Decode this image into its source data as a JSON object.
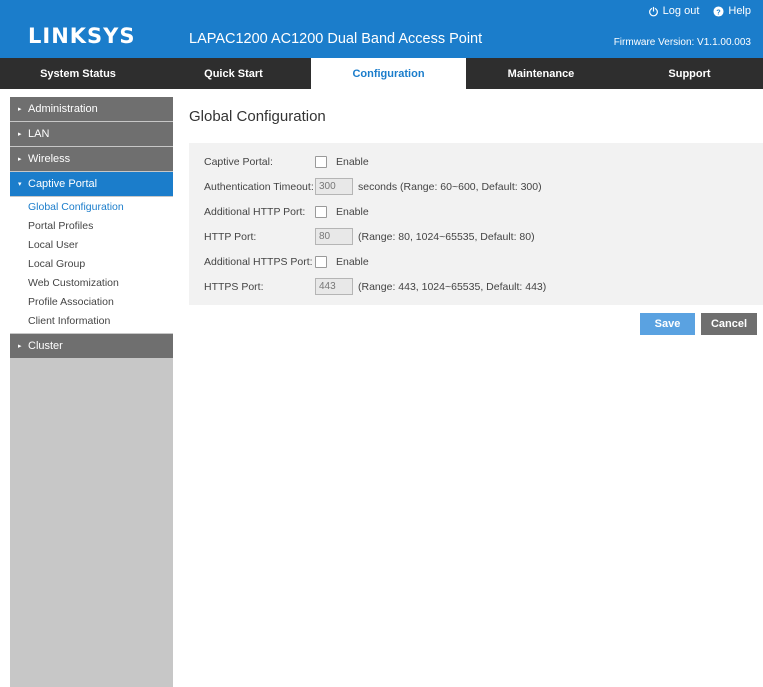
{
  "header": {
    "logo": "LINKSYS",
    "product": "LAPAC1200 AC1200 Dual Band Access Point",
    "logout": "Log out",
    "help": "Help",
    "firmware": "Firmware Version: V1.1.00.003"
  },
  "nav": {
    "tabs": [
      {
        "label": "System Status"
      },
      {
        "label": "Quick Start"
      },
      {
        "label": "Configuration",
        "active": true
      },
      {
        "label": "Maintenance"
      },
      {
        "label": "Support"
      }
    ]
  },
  "sidebar": {
    "sections": [
      {
        "label": "Administration"
      },
      {
        "label": "LAN"
      },
      {
        "label": "Wireless"
      },
      {
        "label": "Captive Portal",
        "active": true,
        "items": [
          "Global Configuration",
          "Portal Profiles",
          "Local User",
          "Local Group",
          "Web Customization",
          "Profile Association",
          "Client Information"
        ]
      },
      {
        "label": "Cluster"
      }
    ]
  },
  "main": {
    "title": "Global Configuration",
    "captive_portal": {
      "label": "Captive Portal:",
      "option": "Enable"
    },
    "auth_timeout": {
      "label": "Authentication Timeout:",
      "value": "300",
      "hint": "seconds (Range: 60~600, Default: 300)"
    },
    "add_http": {
      "label": "Additional HTTP Port:",
      "option": "Enable"
    },
    "http_port": {
      "label": "HTTP Port:",
      "value": "80",
      "hint": "(Range: 80, 1024~65535, Default: 80)"
    },
    "add_https": {
      "label": "Additional HTTPS Port:",
      "option": "Enable"
    },
    "https_port": {
      "label": "HTTPS Port:",
      "value": "443",
      "hint": "(Range: 443, 1024~65535, Default: 443)"
    },
    "save": "Save",
    "cancel": "Cancel"
  },
  "colors": {
    "accent": "#1b7dcb",
    "nav_bg": "#2e2e2e",
    "sidebar_bg": "#c7c7c7",
    "sidebar_head": "#6f6f6f",
    "save_btn": "#5aa2e1"
  }
}
